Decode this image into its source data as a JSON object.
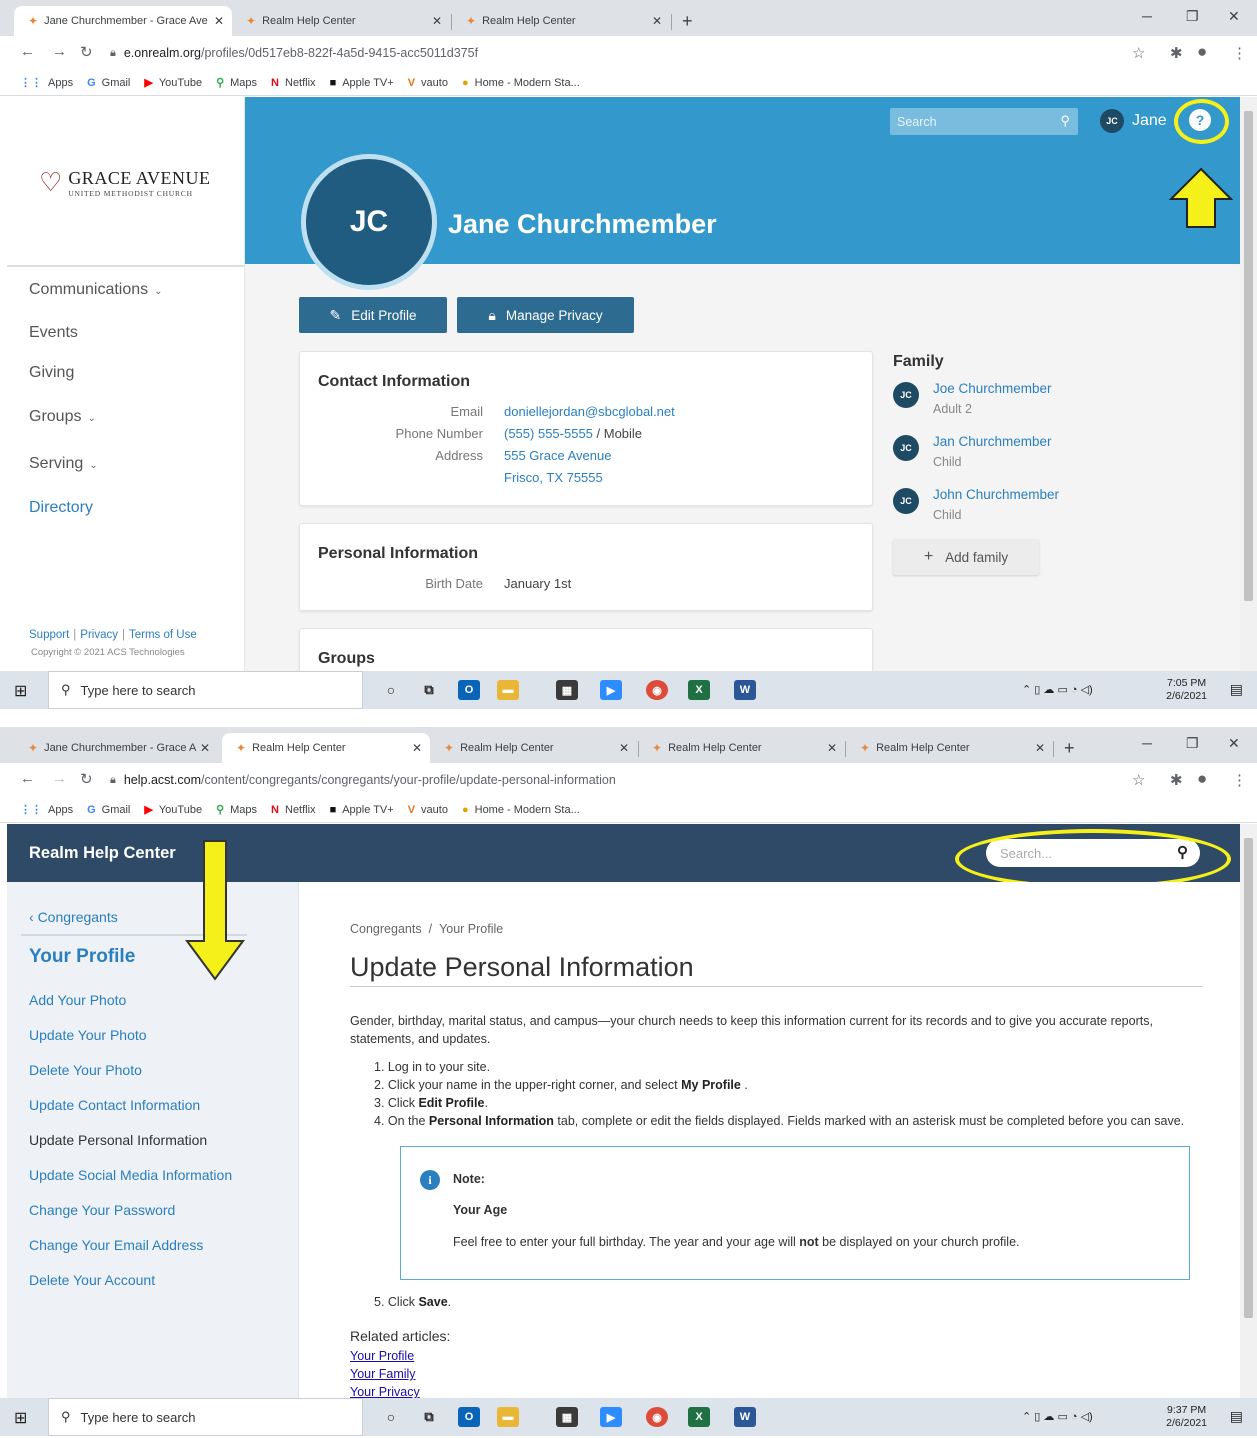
{
  "top": {
    "tabs": [
      {
        "label": "Jane Churchmember - Grace Ave",
        "active": true
      },
      {
        "label": "Realm Help Center",
        "active": false
      },
      {
        "label": "Realm Help Center",
        "active": false
      }
    ],
    "url_host": "e.onrealm.org",
    "url_path": "/profiles/0d517eb8-822f-4a5d-9415-acc5011d375f",
    "bookmarks": [
      {
        "label": "Apps",
        "icon": "apps-grid-icon"
      },
      {
        "label": "Gmail",
        "icon": "google-icon"
      },
      {
        "label": "YouTube",
        "icon": "youtube-icon"
      },
      {
        "label": "Maps",
        "icon": "maps-pin-icon"
      },
      {
        "label": "Netflix",
        "icon": "netflix-icon"
      },
      {
        "label": "Apple TV+",
        "icon": "appletv-icon"
      },
      {
        "label": "vauto",
        "icon": "vauto-icon"
      },
      {
        "label": "Home - Modern Sta...",
        "icon": "home-icon"
      }
    ],
    "realm": {
      "logo_line1": "GRACE AVENUE",
      "logo_line2": "UNITED METHODIST CHURCH",
      "nav": [
        {
          "label": "Communications",
          "has_chevron": true
        },
        {
          "label": "Events",
          "has_chevron": false
        },
        {
          "label": "Giving",
          "has_chevron": false
        },
        {
          "label": "Groups",
          "has_chevron": true
        },
        {
          "label": "Serving",
          "has_chevron": true
        },
        {
          "label": "Directory",
          "has_chevron": false
        }
      ],
      "footer_links": [
        "Support",
        "Privacy",
        "Terms of Use"
      ],
      "copyright": "Copyright © 2021 ACS Technologies",
      "search_placeholder": "Search",
      "user_initials": "JC",
      "user_name": "Jane",
      "help_glyph": "?",
      "profile_initials": "JC",
      "profile_name": "Jane Churchmember",
      "edit_profile": "Edit Profile",
      "manage_privacy": "Manage Privacy",
      "contact": {
        "title": "Contact Information",
        "email_label": "Email",
        "email": "doniellejordan@sbcglobal.net",
        "phone_label": "Phone Number",
        "phone": "(555) 555-5555",
        "phone_suffix": " / Mobile",
        "address_label": "Address",
        "address1": "555 Grace Avenue",
        "address2": "Frisco, TX 75555"
      },
      "personal": {
        "title": "Personal Information",
        "birth_label": "Birth Date",
        "birth": "January 1st"
      },
      "groups_title": "Groups",
      "family_title": "Family",
      "family": [
        {
          "initials": "JC",
          "name": "Joe Churchmember",
          "role": "Adult 2"
        },
        {
          "initials": "JC",
          "name": "Jan Churchmember",
          "role": "Child"
        },
        {
          "initials": "JC",
          "name": "John Churchmember",
          "role": "Child"
        }
      ],
      "add_family": "Add family"
    },
    "taskbar": {
      "search": "Type here to search",
      "time": "7:05 PM",
      "date": "2/6/2021"
    }
  },
  "bottom": {
    "tabs": [
      {
        "label": "Jane Churchmember - Grace A",
        "active": false
      },
      {
        "label": "Realm Help Center",
        "active": true
      },
      {
        "label": "Realm Help Center",
        "active": false
      },
      {
        "label": "Realm Help Center",
        "active": false
      },
      {
        "label": "Realm Help Center",
        "active": false
      }
    ],
    "url_host": "help.acst.com",
    "url_path": "/content/congregants/congregants/your-profile/update-personal-information",
    "help": {
      "header_title": "Realm Help Center",
      "search_placeholder": "Search...",
      "back_label": "Congregants",
      "section_title": "Your Profile",
      "side_links": [
        {
          "label": "Add Your Photo",
          "current": false
        },
        {
          "label": "Update Your Photo",
          "current": false
        },
        {
          "label": "Delete Your Photo",
          "current": false
        },
        {
          "label": "Update Contact Information",
          "current": false
        },
        {
          "label": "Update Personal Information",
          "current": true
        },
        {
          "label": "Update Social Media Information",
          "current": false
        },
        {
          "label": "Change Your Password",
          "current": false
        },
        {
          "label": "Change Your Email Address",
          "current": false
        },
        {
          "label": "Delete Your Account",
          "current": false
        }
      ],
      "crumb1": "Congregants",
      "crumb2": "Your Profile",
      "title": "Update Personal Information",
      "intro": "Gender, birthday, marital status, and campus—your church needs to keep this information current for its records and to give you accurate reports, statements, and updates.",
      "steps": [
        {
          "pre": "1. Log in to your site.",
          "bold": "",
          "post": ""
        },
        {
          "pre": "2. Click your name in the upper-right corner, and select ",
          "bold": "My Profile",
          "post": " ."
        },
        {
          "pre": "3. Click ",
          "bold": "Edit Profile",
          "post": "."
        },
        {
          "pre": "4. On the ",
          "bold": "Personal Information",
          "post": " tab, complete or edit the fields displayed. Fields marked with an asterisk must be completed before you can save."
        }
      ],
      "note_label": "Note:",
      "note_heading": "Your Age",
      "note_pre": "Feel free to enter your full birthday. The year and your age will ",
      "note_bold": "not",
      "note_post": " be displayed on your church profile.",
      "step5_pre": "5. Click ",
      "step5_bold": "Save",
      "step5_post": ".",
      "related_heading": "Related articles:",
      "related": [
        "Your Profile",
        "Your Family",
        "Your Privacy"
      ]
    },
    "taskbar": {
      "search": "Type here to search",
      "time": "9:37 PM",
      "date": "2/6/2021"
    }
  },
  "colors": {
    "realm_banner": "#3399cc",
    "realm_button": "#2e6b90",
    "help_header": "#2e4a66",
    "link_blue": "#2a7fbf",
    "annotation_yellow": "#f6f01a"
  }
}
